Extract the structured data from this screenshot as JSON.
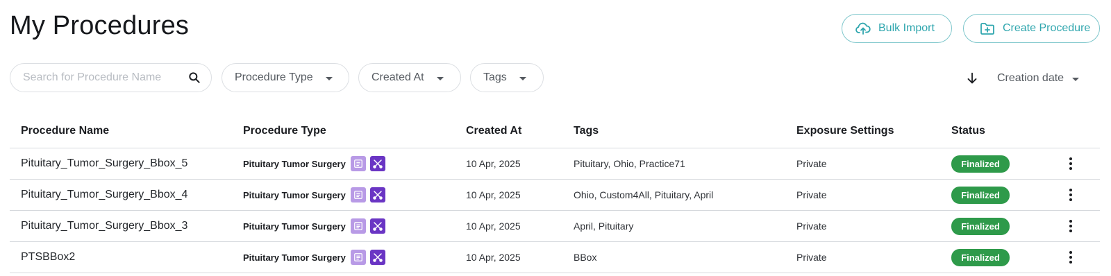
{
  "page": {
    "title": "My Procedures"
  },
  "actions": {
    "bulk_import_label": "Bulk Import",
    "create_procedure_label": "Create Procedure"
  },
  "filters": {
    "search_placeholder": "Search for Procedure Name",
    "procedure_type_label": "Procedure Type",
    "created_at_label": "Created At",
    "tags_label": "Tags"
  },
  "sort": {
    "label": "Creation date",
    "direction": "descending"
  },
  "table": {
    "headers": {
      "name": "Procedure Name",
      "type": "Procedure Type",
      "created_at": "Created At",
      "tags": "Tags",
      "exposure": "Exposure Settings",
      "status": "Status"
    },
    "rows": [
      {
        "name": "Pituitary_Tumor_Surgery_Bbox_5",
        "type": "Pituitary Tumor Surgery",
        "created_at": "10 Apr, 2025",
        "tags": "Pituitary, Ohio, Practice71",
        "exposure": "Private",
        "status": "Finalized"
      },
      {
        "name": "Pituitary_Tumor_Surgery_Bbox_4",
        "type": "Pituitary Tumor Surgery",
        "created_at": "10 Apr, 2025",
        "tags": "Ohio, Custom4All, Pituitary, April",
        "exposure": "Private",
        "status": "Finalized"
      },
      {
        "name": "Pituitary_Tumor_Surgery_Bbox_3",
        "type": "Pituitary Tumor Surgery",
        "created_at": "10 Apr, 2025",
        "tags": "April, Pituitary",
        "exposure": "Private",
        "status": "Finalized"
      },
      {
        "name": "PTSBBox2",
        "type": "Pituitary Tumor Surgery",
        "created_at": "10 Apr, 2025",
        "tags": "BBox",
        "exposure": "Private",
        "status": "Finalized"
      }
    ]
  },
  "icons": {
    "bulk_import": "cloud-upload-icon",
    "create_procedure": "folder-add-icon",
    "search": "search-icon",
    "sort": "arrow-down-icon",
    "type_doc": "document-icon",
    "type_tool": "scissors-icon",
    "row_menu": "more-vertical-icon"
  },
  "colors": {
    "accent": "#2fa6ae",
    "status_finalized": "#2e9a4a",
    "type_icon_light": "#b89ae6",
    "type_icon_dark": "#6a35c4"
  }
}
